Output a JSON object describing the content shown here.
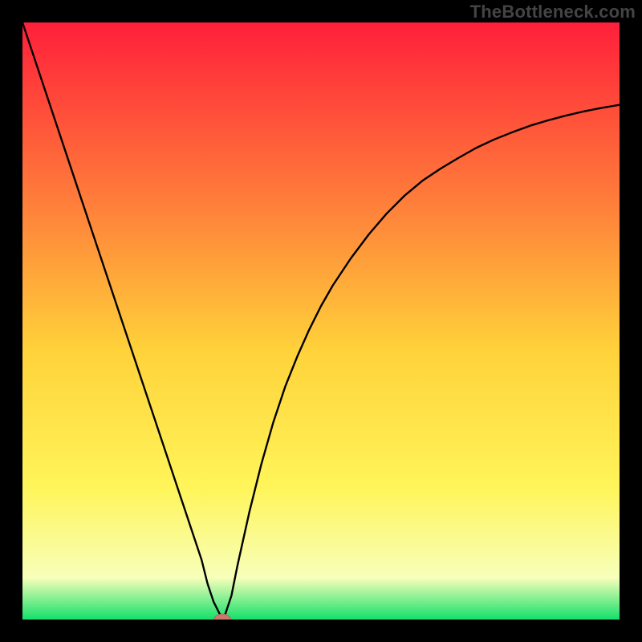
{
  "watermark": "TheBottleneck.com",
  "colors": {
    "frame": "#000000",
    "curve": "#000000",
    "marker_fill": "#c97b6b",
    "marker_stroke": "#b3655a",
    "grad_top": "#ff1f3a",
    "grad_mid_upper": "#ff843a",
    "grad_mid": "#ffd23a",
    "grad_mid_lower": "#fff55a",
    "grad_low": "#f7ffba",
    "grad_bottom": "#14e06a"
  },
  "chart_data": {
    "type": "line",
    "title": "",
    "xlabel": "",
    "ylabel": "",
    "xlim": [
      0,
      100
    ],
    "ylim": [
      0,
      100
    ],
    "x": [
      0,
      2,
      4,
      6,
      8,
      10,
      12,
      14,
      16,
      18,
      20,
      22,
      24,
      26,
      28,
      30,
      31,
      32,
      33,
      33.5,
      34,
      35,
      36,
      38,
      40,
      42,
      44,
      46,
      48,
      50,
      52,
      55,
      58,
      61,
      64,
      67,
      70,
      73,
      76,
      79,
      82,
      85,
      88,
      91,
      94,
      97,
      100
    ],
    "values": [
      100,
      94,
      88,
      82,
      76,
      70,
      64,
      58,
      52,
      46,
      40,
      34,
      28,
      22,
      16,
      10,
      6,
      3,
      1,
      0,
      1,
      4,
      9,
      18,
      26,
      33,
      39,
      44,
      48.5,
      52.5,
      56,
      60.5,
      64.5,
      68,
      71,
      73.5,
      75.5,
      77.3,
      79,
      80.4,
      81.6,
      82.7,
      83.6,
      84.4,
      85.1,
      85.7,
      86.2
    ],
    "marker": {
      "x": 33.5,
      "y": 0,
      "rx": 1.4,
      "ry": 0.9
    },
    "annotations": []
  }
}
